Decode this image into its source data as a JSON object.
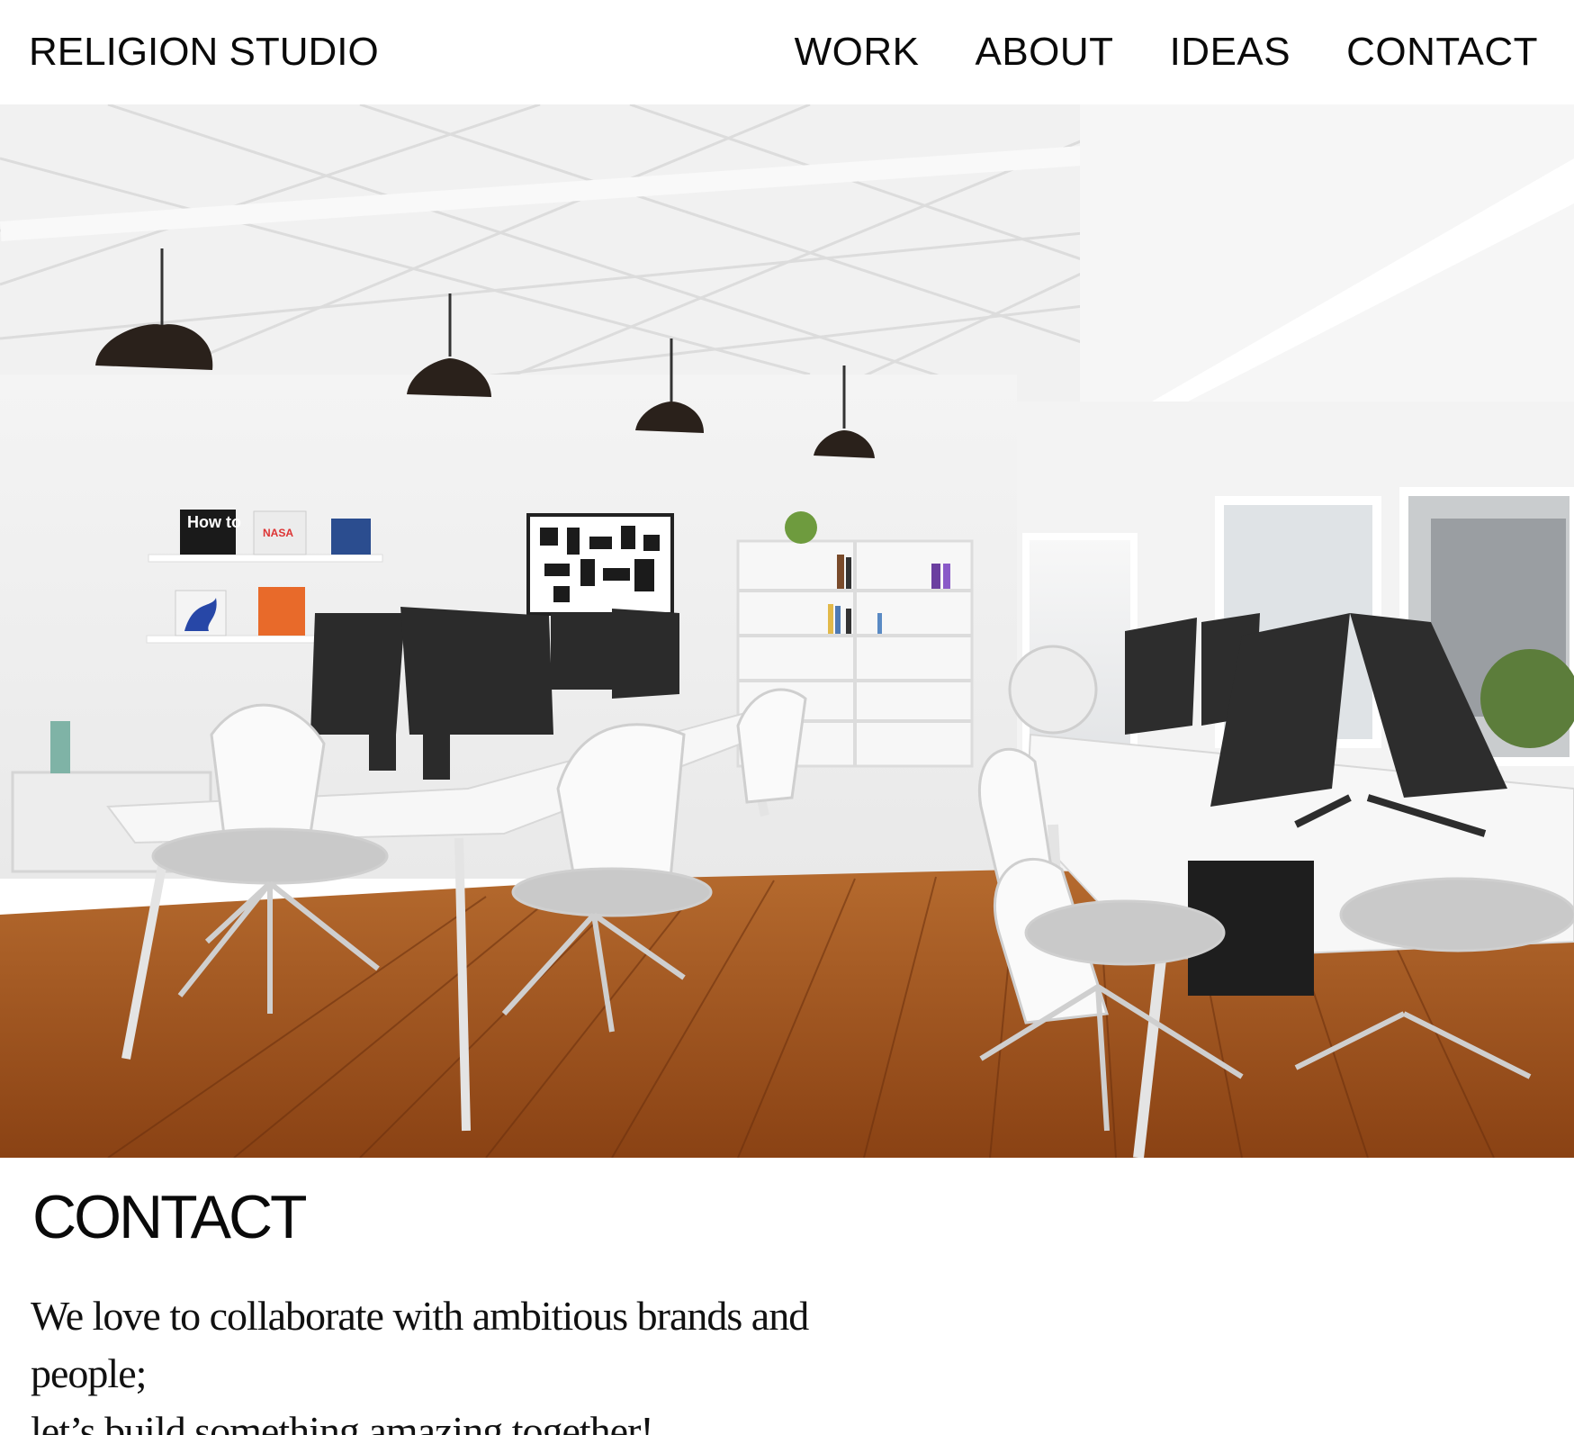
{
  "header": {
    "brand": "RELIGION STUDIO",
    "nav": [
      {
        "label": "WORK"
      },
      {
        "label": "ABOUT"
      },
      {
        "label": "IDEAS"
      },
      {
        "label": "CONTACT"
      }
    ]
  },
  "hero": {
    "poster_how_to": "How to",
    "poster_nasa": "NASA"
  },
  "contact": {
    "title": "CONTACT",
    "intro_line1": "We love to collaborate with ambitious brands and people;",
    "intro_line2": "let’s build something amazing together!"
  },
  "colors": {
    "text": "#0a0a0a",
    "background": "#ffffff",
    "floor": "#9c4f1e",
    "orange_book": "#e86a2a"
  }
}
